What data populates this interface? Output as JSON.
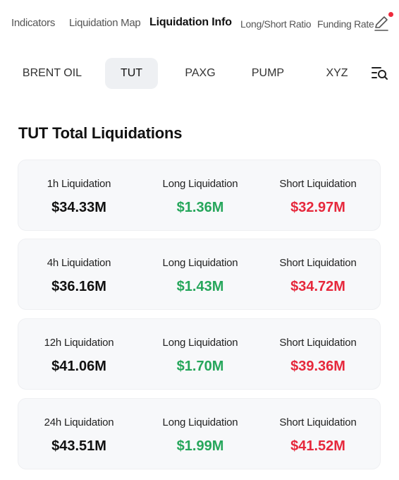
{
  "top_tabs": [
    "Indicators",
    "Liquidation Map",
    "Liquidation Info",
    "Long/Short Ratio",
    "Funding Rate"
  ],
  "symbol_tabs": [
    "BRENT OIL",
    "TUT",
    "PAXG",
    "PUMP",
    "XYZ"
  ],
  "section_title": "TUT Total Liquidations",
  "colors": {
    "long": "#26a65b",
    "short": "#e6283c",
    "card_bg": "#f7f8fa",
    "active_tab_bg": "#eef0f3",
    "notification": "#ee2a3c"
  },
  "icons": {
    "edit": "pencil-icon",
    "filter": "search-list-icon"
  },
  "cards": [
    {
      "period_label": "1h Liquidation",
      "total": "$34.33M",
      "long_label": "Long Liquidation",
      "long": "$1.36M",
      "short_label": "Short Liquidation",
      "short": "$32.97M"
    },
    {
      "period_label": "4h Liquidation",
      "total": "$36.16M",
      "long_label": "Long Liquidation",
      "long": "$1.43M",
      "short_label": "Short Liquidation",
      "short": "$34.72M"
    },
    {
      "period_label": "12h Liquidation",
      "total": "$41.06M",
      "long_label": "Long Liquidation",
      "long": "$1.70M",
      "short_label": "Short Liquidation",
      "short": "$39.36M"
    },
    {
      "period_label": "24h Liquidation",
      "total": "$43.51M",
      "long_label": "Long Liquidation",
      "long": "$1.99M",
      "short_label": "Short Liquidation",
      "short": "$41.52M"
    }
  ]
}
